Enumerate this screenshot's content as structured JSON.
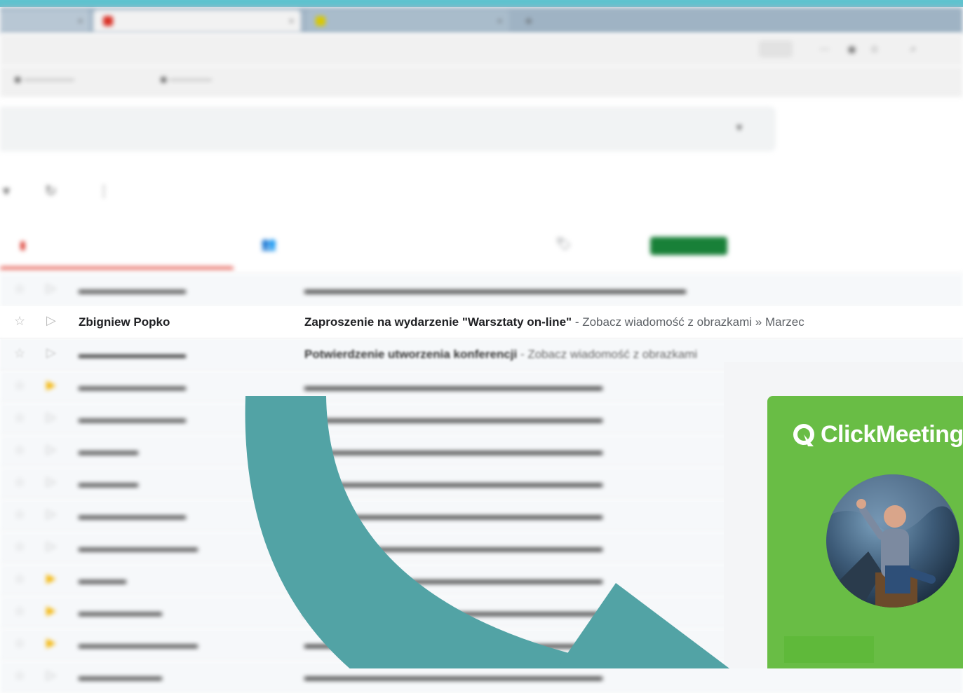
{
  "colors": {
    "accent_teal": "#52a3a5",
    "clickmeeting_green": "#69bd45",
    "primary_tab_red": "#d93025",
    "new_badge_green": "#188038"
  },
  "focused_email": {
    "sender": "Zbigniew Popko",
    "subject": "Zaproszenie na wydarzenie \"Warsztaty on-line\"",
    "snippet": " - Zobacz wiadomość z obrazkami » Marzec"
  },
  "visible_partial_email": {
    "subject": "Potwierdzenie utworzenia konferencji",
    "snippet": " - Zobacz wiadomość z obrazkami"
  },
  "popup": {
    "brand": "ClickMeeting"
  }
}
